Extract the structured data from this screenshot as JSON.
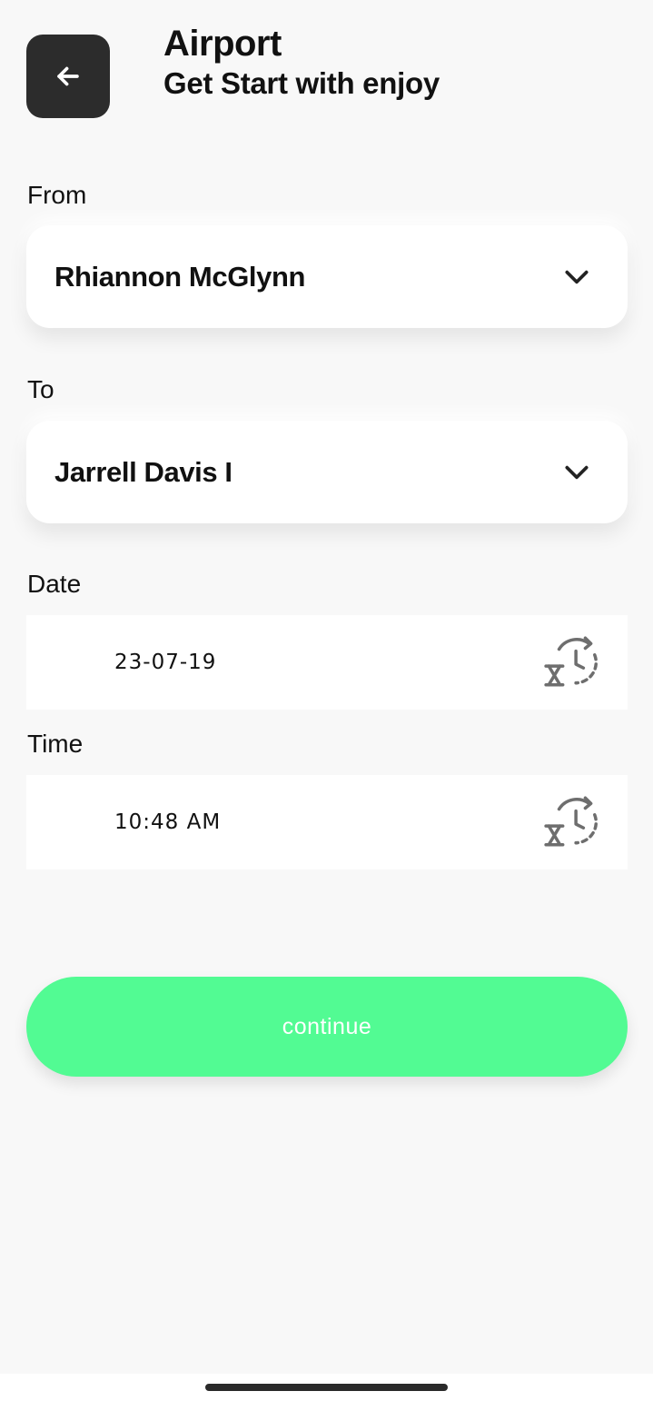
{
  "header": {
    "title": "Airport",
    "subtitle": "Get Start with enjoy",
    "back_icon": "arrow-left-icon"
  },
  "form": {
    "from": {
      "label": "From",
      "value": "Rhiannon McGlynn",
      "icon": "chevron-down-icon"
    },
    "to": {
      "label": "To",
      "value": "Jarrell Davis I",
      "icon": "chevron-down-icon"
    },
    "date": {
      "label": "Date",
      "value": "23-07-19",
      "icon": "history-clock-icon"
    },
    "time": {
      "label": "Time",
      "value": "10:48 AM",
      "icon": "history-clock-icon"
    }
  },
  "actions": {
    "continue_label": "continue"
  },
  "colors": {
    "background": "#f8f8f8",
    "back_button": "#2c2c2c",
    "accent": "#52fb93",
    "icon_gray": "#6e6e6e"
  }
}
